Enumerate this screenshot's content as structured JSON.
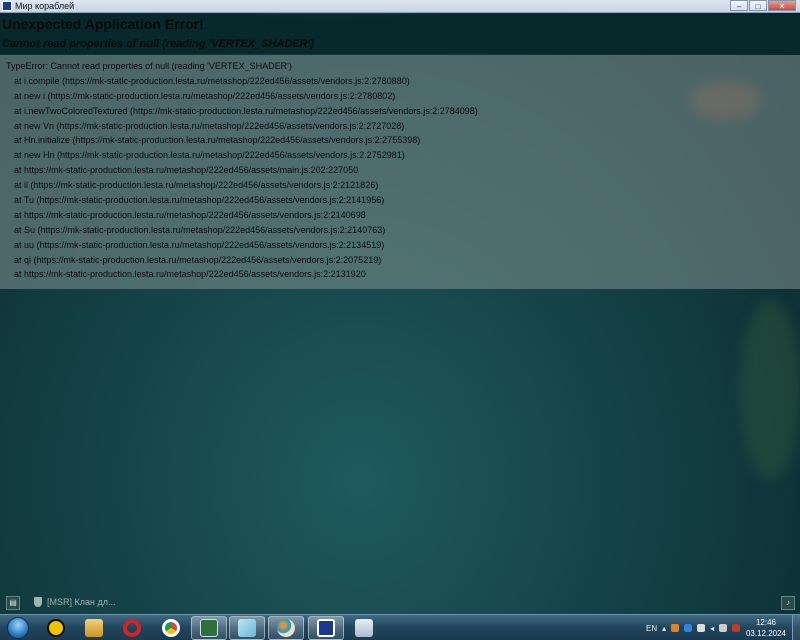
{
  "window": {
    "title": "Мир кораблей",
    "controls": [
      "–",
      "□",
      "✕"
    ]
  },
  "error": {
    "title": "Unexpected Application Error!",
    "subtitle": "Cannot read properties of null (reading 'VERTEX_SHADER')",
    "trace": [
      "TypeError: Cannot read properties of null (reading 'VERTEX_SHADER')",
      "at i.compile (https://mk-static-production.lesta.ru/metashop/222ed456/assets/vendors.js:2:2780880)",
      "at new i (https://mk-static-production.lesta.ru/metashop/222ed456/assets/vendors.js:2:2780802)",
      "at i.newTwoColoredTextured (https://mk-static-production.lesta.ru/metashop/222ed456/assets/vendors.js:2:2784098)",
      "at new Vn (https://mk-static-production.lesta.ru/metashop/222ed456/assets/vendors.js:2:2727028)",
      "at Hn.initialize (https://mk-static-production.lesta.ru/metashop/222ed456/assets/vendors.js:2:2755398)",
      "at new Hn (https://mk-static-production.lesta.ru/metashop/222ed456/assets/vendors.js:2:2752981)",
      "at https://mk-static-production.lesta.ru/metashop/222ed456/assets/main.js:202:227050",
      "at il (https://mk-static-production.lesta.ru/metashop/222ed456/assets/vendors.js:2:2121826)",
      "at Tu (https://mk-static-production.lesta.ru/metashop/222ed456/assets/vendors.js:2:2141956)",
      "at https://mk-static-production.lesta.ru/metashop/222ed456/assets/vendors.js:2:2140698",
      "at Su (https://mk-static-production.lesta.ru/metashop/222ed456/assets/vendors.js:2:2140763)",
      "at uu (https://mk-static-production.lesta.ru/metashop/222ed456/assets/vendors.js:2:2134519)",
      "at qi (https://mk-static-production.lesta.ru/metashop/222ed456/assets/vendors.js:2:2075219)",
      "at https://mk-static-production.lesta.ru/metashop/222ed456/assets/vendors.js:2:2131920"
    ]
  },
  "overlay": {
    "clan_chat_label": "[MSR] Клан дл...",
    "chat_icon": "chat-bubble-icon",
    "notification_icon": "bell-icon"
  },
  "taskbar": {
    "pinned": [
      {
        "name": "explorer-icon",
        "color": "#e8b64a"
      },
      {
        "name": "opera-icon",
        "color": "#d2232a"
      },
      {
        "name": "chrome-icon",
        "color": "#3c9a46"
      },
      {
        "name": "terminal-icon",
        "color": "#2f6f3a"
      },
      {
        "name": "notes-icon",
        "color": "#8fd0e8"
      },
      {
        "name": "paint-icon",
        "color": "#e8e2c8"
      },
      {
        "name": "game-launcher-icon",
        "color": "#1b3a8c"
      },
      {
        "name": "calculator-icon",
        "color": "#c8d6e4"
      }
    ],
    "aimp_color": "#f2c300",
    "language": "EN",
    "time": "12:46",
    "date": "03.12.2024"
  },
  "colors": {
    "accent": "#1b3a8c",
    "background": "#154448"
  }
}
